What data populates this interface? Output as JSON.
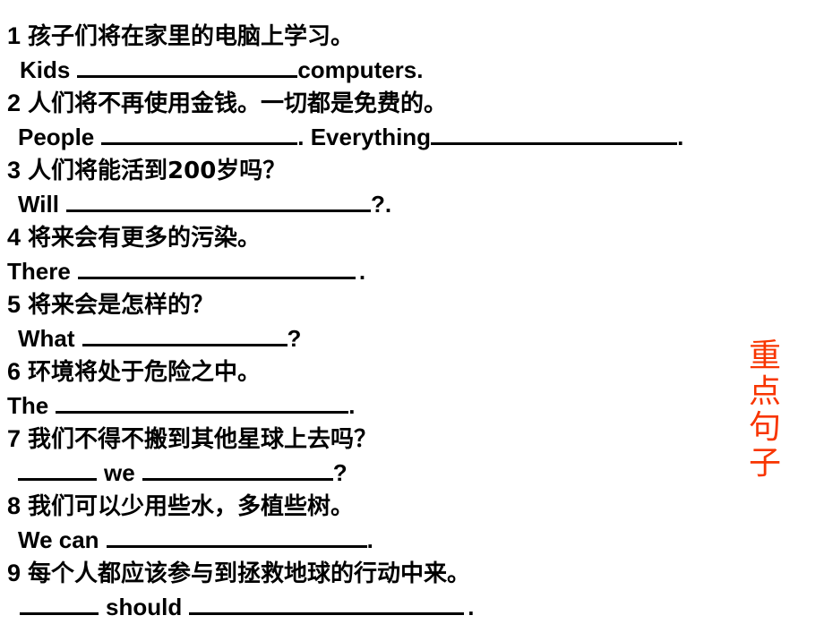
{
  "slide": {
    "background_color": "#ffffff",
    "heading_vertical": {
      "text": "重点句子",
      "chars": [
        "重",
        "点",
        "句",
        "子"
      ],
      "color": "#f83500"
    },
    "exercises": [
      {
        "number": "1",
        "chinese": "孩子们将在家里的电脑上学习。",
        "lead": "Kids",
        "mid": "",
        "tail": "computers.",
        "blank1_width": 246,
        "blank2_width": 0
      },
      {
        "number": "2",
        "chinese": "人们将不再使用金钱。一切都是免费的。",
        "lead": "People",
        "mid": ". Everything",
        "tail": ".",
        "blank1_width": 219,
        "blank2_width": 275
      },
      {
        "number": "3",
        "chinese": "人们将能活到200岁吗？",
        "lead": "Will",
        "mid": "",
        "tail": "?.",
        "blank1_width": 340,
        "blank2_width": 0
      },
      {
        "number": "4",
        "chinese": "将来会有更多的污染。",
        "lead": "There",
        "mid": "",
        "tail": " .",
        "blank1_width": 310,
        "blank2_width": 0
      },
      {
        "number": "5",
        "chinese": "将来会是怎样的？",
        "lead": "What",
        "mid": "",
        "tail": "?",
        "blank1_width": 229,
        "blank2_width": 0
      },
      {
        "number": "6",
        "chinese": "环境将处于危险之中。",
        "lead": "The",
        "mid": "",
        "tail": ".",
        "blank1_width": 327,
        "blank2_width": 0
      },
      {
        "number": "7",
        "chinese": "我们不得不搬到其他星球上去吗？",
        "lead": "we",
        "mid": "",
        "tail": "?",
        "leading_blank_width": 88,
        "blank1_width": 213,
        "blank2_width": 0
      },
      {
        "number": "8",
        "chinese": "我们可以少用些水，多植些树。",
        "lead": "We can",
        "mid": "",
        "tail": ".",
        "blank1_width": 291,
        "blank2_width": 0
      },
      {
        "number": "9",
        "chinese": "每个人都应该参与到拯救地球的行动中来。",
        "lead": "should",
        "mid": "",
        "tail": " .",
        "leading_blank_width": 88,
        "blank1_width": 307,
        "blank2_width": 0
      }
    ]
  }
}
